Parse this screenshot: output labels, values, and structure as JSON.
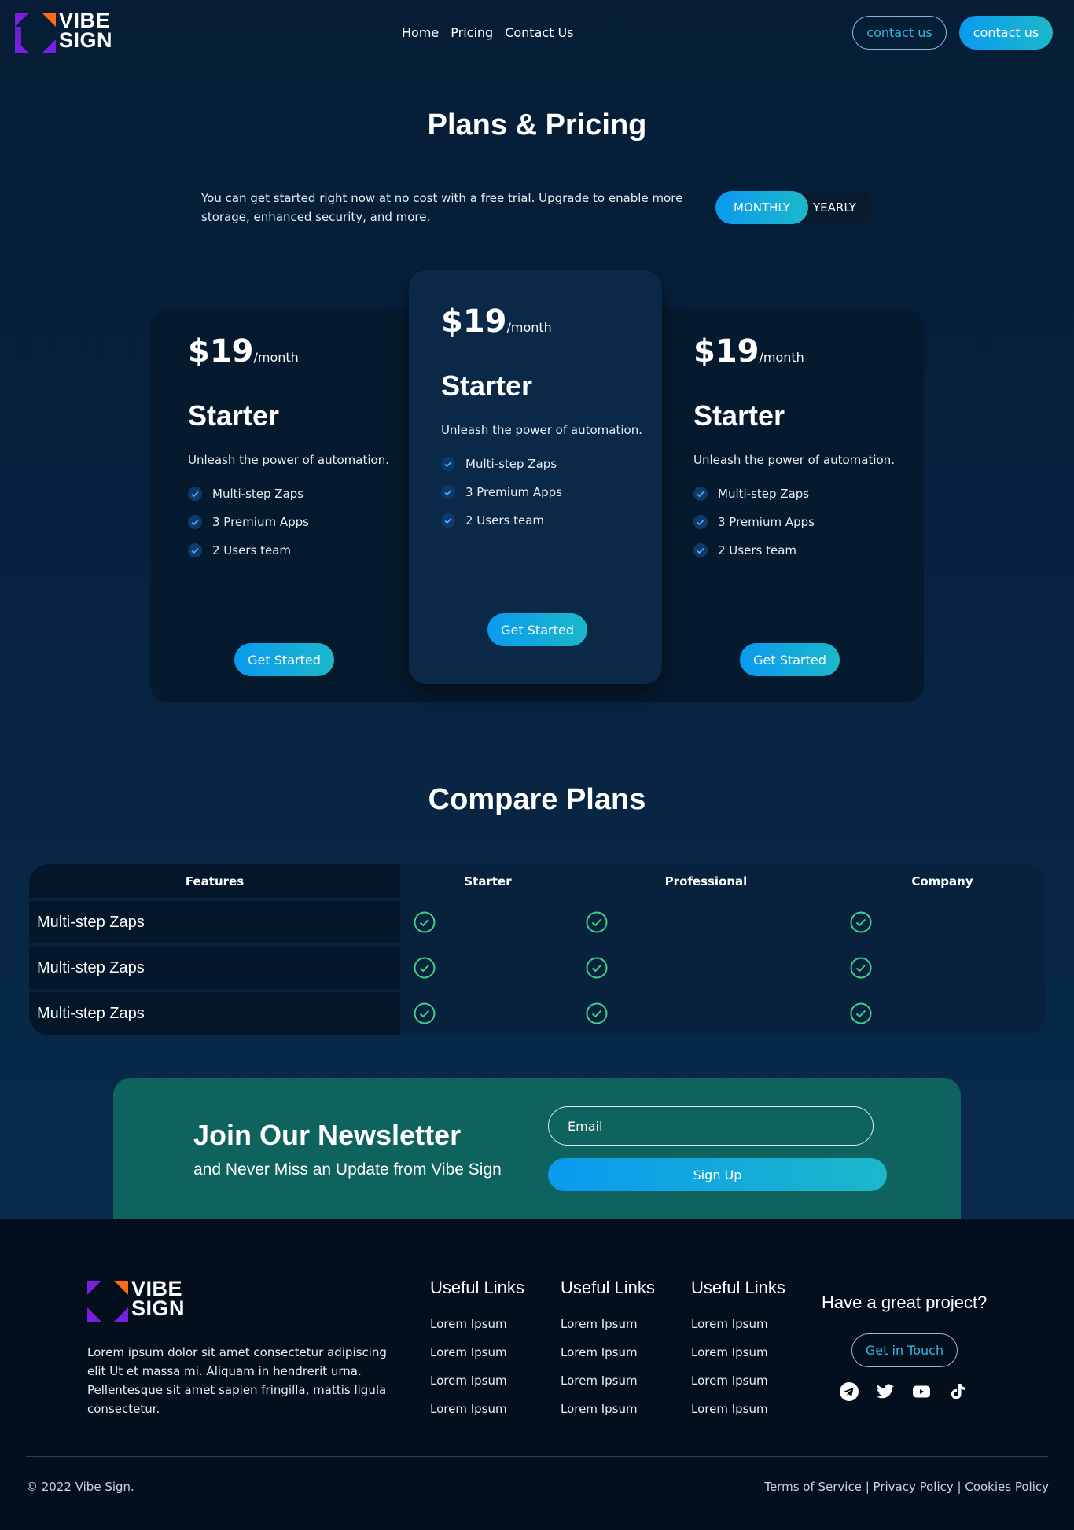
{
  "brand": {
    "line1": "VIBE",
    "line2": "SIGN"
  },
  "nav": {
    "items": [
      "Home",
      "Pricing",
      "Contact Us"
    ]
  },
  "header": {
    "outline_btn": "contact us",
    "fill_btn": "contact us"
  },
  "pricing": {
    "title": "Plans & Pricing",
    "intro": "You can get started right now at no cost with a free trial. Upgrade to enable more storage, enhanced security, and more.",
    "toggle": {
      "active": "MONTHLY",
      "inactive": "YEARLY"
    },
    "cards": [
      {
        "price": "$19",
        "period": "/month",
        "name": "Starter",
        "desc": "Unleash the power of automation.",
        "features": [
          "Multi-step Zaps",
          "3 Premium Apps",
          "2 Users team"
        ],
        "cta": "Get Started"
      },
      {
        "price": "$19",
        "period": "/month",
        "name": "Starter",
        "desc": "Unleash the power of automation.",
        "features": [
          "Multi-step Zaps",
          "3 Premium Apps",
          "2 Users team"
        ],
        "cta": "Get Started"
      },
      {
        "price": "$19",
        "period": "/month",
        "name": "Starter",
        "desc": "Unleash the power of automation.",
        "features": [
          "Multi-step Zaps",
          "3 Premium Apps",
          "2 Users team"
        ],
        "cta": "Get Started"
      }
    ]
  },
  "compare": {
    "title": "Compare Plans",
    "headers": [
      "Features",
      "Starter",
      "Professional",
      "Company"
    ],
    "rows": [
      "Multi-step Zaps",
      "Multi-step Zaps",
      "Multi-step Zaps"
    ]
  },
  "newsletter": {
    "title": "Join Our Newsletter",
    "subtitle": "and Never Miss an Update from Vibe Sign",
    "email_placeholder": "Email",
    "button": "Sign Up"
  },
  "footer": {
    "desc": "Lorem ipsum dolor sit amet consectetur adipiscing elit Ut et massa mi. Aliquam in hendrerit urna. Pellentesque sit amet sapien fringilla, mattis ligula consectetur.",
    "columns": [
      {
        "title": "Useful Links",
        "links": [
          "Lorem Ipsum",
          "Lorem Ipsum",
          "Lorem Ipsum",
          "Lorem Ipsum"
        ]
      },
      {
        "title": "Useful Links",
        "links": [
          "Lorem Ipsum",
          "Lorem Ipsum",
          "Lorem Ipsum",
          "Lorem Ipsum"
        ]
      },
      {
        "title": "Useful Links",
        "links": [
          "Lorem Ipsum",
          "Lorem Ipsum",
          "Lorem Ipsum",
          "Lorem Ipsum"
        ]
      }
    ],
    "project_title": "Have a great project?",
    "touch_btn": "Get in Touch",
    "socials": [
      "telegram-icon",
      "twitter-icon",
      "youtube-icon",
      "tiktok-icon"
    ],
    "copyright": "© 2022 Vibe Sign.",
    "legal": "Terms of Service | Privacy Policy | Cookies Policy"
  },
  "colors": {
    "accent_start": "#0a9af0",
    "accent_end": "#1cb8c9",
    "check": "#3fd18a",
    "newsletter_bg": "#0f635f"
  }
}
